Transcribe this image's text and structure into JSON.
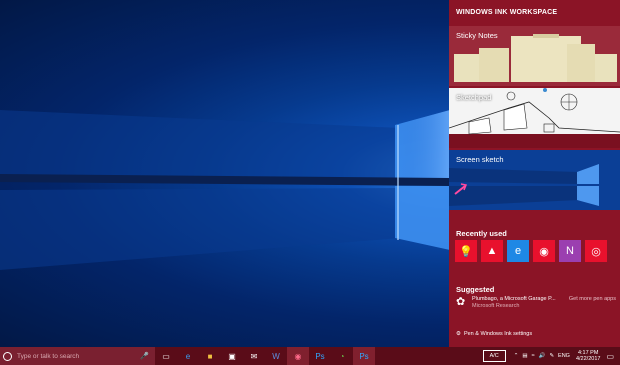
{
  "ink_workspace": {
    "title": "WINDOWS INK WORKSPACE",
    "tiles": [
      {
        "label": "Sticky Notes"
      },
      {
        "label": "Sketchpad"
      },
      {
        "label": "Screen sketch"
      }
    ],
    "recently_used": {
      "title": "Recently used",
      "apps": [
        {
          "icon": "bulb-icon",
          "color": "#e8112d"
        },
        {
          "icon": "photos-icon",
          "color": "#e8112d"
        },
        {
          "icon": "edge-icon",
          "color": "#1e88e5"
        },
        {
          "icon": "maps-pin-icon",
          "color": "#e8112d"
        },
        {
          "icon": "onenote-icon",
          "color": "#9b3fb0"
        },
        {
          "icon": "webcam-icon",
          "color": "#e8112d"
        }
      ]
    },
    "suggested": {
      "title": "Suggested",
      "app_name": "Plumbago, a Microsoft Garage P...",
      "publisher": "Microsoft Research",
      "more": "Get more pen apps"
    },
    "settings_link": "Pen & Windows Ink settings"
  },
  "taskbar": {
    "search_placeholder": "Type or talk to search",
    "ac_label": "A/C",
    "language": "ENG",
    "time": "4:17 PM",
    "date": "4/22/2017"
  }
}
